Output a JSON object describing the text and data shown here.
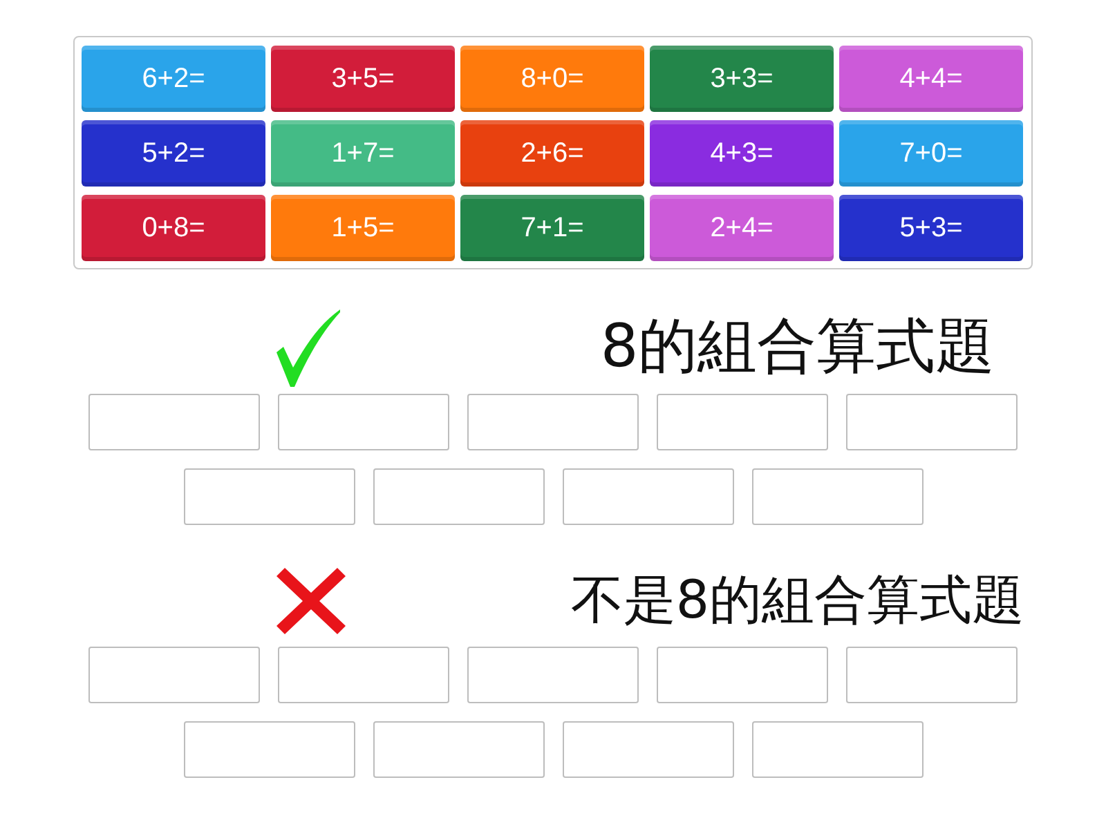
{
  "tiles": [
    {
      "label": "6+2=",
      "color": "#2aa4ea"
    },
    {
      "label": "3+5=",
      "color": "#d21d3a"
    },
    {
      "label": "8+0=",
      "color": "#ff7a0c"
    },
    {
      "label": "3+3=",
      "color": "#23864a"
    },
    {
      "label": "4+4=",
      "color": "#cc5ad9"
    },
    {
      "label": "5+2=",
      "color": "#2531cc"
    },
    {
      "label": "1+7=",
      "color": "#44bb86"
    },
    {
      "label": "2+6=",
      "color": "#e8410f"
    },
    {
      "label": "4+3=",
      "color": "#8a2ce0"
    },
    {
      "label": "7+0=",
      "color": "#2aa4ea"
    },
    {
      "label": "0+8=",
      "color": "#d21d3a"
    },
    {
      "label": "1+5=",
      "color": "#ff7a0c"
    },
    {
      "label": "7+1=",
      "color": "#23864a"
    },
    {
      "label": "2+4=",
      "color": "#cc5ad9"
    },
    {
      "label": "5+3=",
      "color": "#2531cc"
    }
  ],
  "groups": [
    {
      "kind": "check",
      "title": "8的組合算式題"
    },
    {
      "kind": "cross",
      "title": "不是8的組合算式題"
    }
  ]
}
